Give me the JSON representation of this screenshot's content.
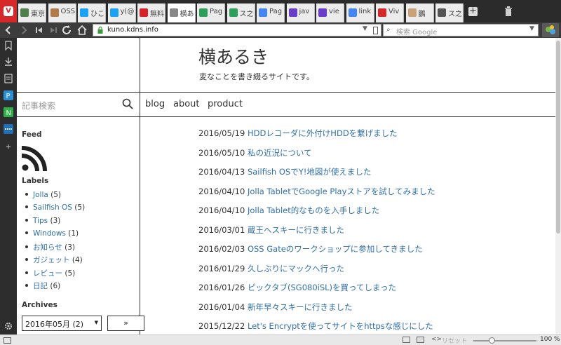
{
  "browser": {
    "tabs": [
      {
        "label": "東京",
        "icon": "nature-favicon",
        "color": "#4f7f4a"
      },
      {
        "label": "OSS",
        "icon": "avatar-favicon",
        "color": "#b07a4a"
      },
      {
        "label": "ひこ",
        "icon": "twitter-favicon",
        "color": "#1da1f2"
      },
      {
        "label": "y(@",
        "icon": "twitter-favicon",
        "color": "#1da1f2"
      },
      {
        "label": "無料",
        "icon": "yahoo-favicon",
        "color": "#d8232a"
      },
      {
        "label": "横あ",
        "icon": "site-favicon",
        "color": "#888888"
      },
      {
        "label": "Pag",
        "icon": "google-translate-favicon",
        "color": "#2e9e5b"
      },
      {
        "label": "ス之",
        "icon": "page-favicon",
        "color": "#2e9e5b"
      },
      {
        "label": "Pag",
        "icon": "google-favicon",
        "color": "#4285f4"
      },
      {
        "label": "jav",
        "icon": "dev-favicon",
        "color": "#6a3ec8"
      },
      {
        "label": "vie",
        "icon": "dev-favicon",
        "color": "#6a3ec8"
      },
      {
        "label": "link",
        "icon": "google-favicon",
        "color": "#4285f4"
      },
      {
        "label": "Viv",
        "icon": "vivaldi-favicon",
        "color": "#d62828"
      },
      {
        "label": "鵬",
        "icon": "avatar-favicon",
        "color": "#c9a27a"
      },
      {
        "label": "ス之",
        "icon": "grid-favicon",
        "color": "#555555"
      }
    ],
    "active_tab_index": 5,
    "url": "kuno.kdns.info",
    "search_placeholder": "検索 Google",
    "zoom_label": "100 %",
    "reset_label": "リセット"
  },
  "site": {
    "title": "横あるき",
    "description": "変なことを書き綴るサイトです。",
    "search_placeholder": "記事検索",
    "nav": [
      "blog",
      "about",
      "product"
    ]
  },
  "sidebar": {
    "feed_heading": "Feed",
    "labels_heading": "Labels",
    "labels": [
      {
        "name": "Jolla",
        "count": "(5)"
      },
      {
        "name": "Sailfish OS",
        "count": "(5)"
      },
      {
        "name": "Tips",
        "count": "(3)"
      },
      {
        "name": "Windows",
        "count": "(1)"
      },
      {
        "name": "お知らせ",
        "count": "(3)"
      },
      {
        "name": "ガジェット",
        "count": "(4)"
      },
      {
        "name": "レビュー",
        "count": "(5)"
      },
      {
        "name": "日記",
        "count": "(6)"
      }
    ],
    "archives_heading": "Archives",
    "archive_selected": "2016年05月 (2)",
    "archive_go": "»"
  },
  "posts": [
    {
      "date": "2016/05/19",
      "title": "HDDレコーダに外付けHDDを繋げました"
    },
    {
      "date": "2016/05/10",
      "title": "私の近況について"
    },
    {
      "date": "2016/04/13",
      "title": "Sailfish OSでY!地図が使えました"
    },
    {
      "date": "2016/04/10",
      "title": "Jolla TabletでGoogle Playストアを試してみました"
    },
    {
      "date": "2016/04/10",
      "title": "Jolla Tablet的なものを入手しました"
    },
    {
      "date": "2016/03/01",
      "title": "蔵王へスキーに行きました"
    },
    {
      "date": "2016/02/03",
      "title": "OSS Gateのワークショップに参加してきました"
    },
    {
      "date": "2016/01/29",
      "title": "久しぶりにマックへ行った"
    },
    {
      "date": "2016/01/26",
      "title": "ピックタブ(SG080iSL)を買ってしまった"
    },
    {
      "date": "2016/01/04",
      "title": "新年早々スキーに行きました"
    },
    {
      "date": "2015/12/22",
      "title": "Let's Encryptを使ってサイトをhttpsな感じにした"
    }
  ],
  "colors": {
    "link": "#2f6fa8",
    "vivaldi_red": "#d62828",
    "chrome_dark": "#2b2b2b"
  }
}
